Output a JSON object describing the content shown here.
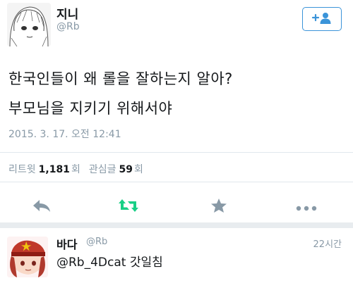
{
  "tweet": {
    "display_name": "지니",
    "handle": "@Rb",
    "text_line1": "한국인들이 왜 롤을 잘하는지 알아?",
    "text_line2": "부모님을 지키기 위해서야",
    "timestamp": "2015. 3. 17. 오전 12:41",
    "follow_icon": "add-user-icon",
    "stats": {
      "retweets_label": "리트윗",
      "retweets_value": "1,181",
      "retweets_unit": "회",
      "favorites_label": "관심글",
      "favorites_value": "59",
      "favorites_unit": "회"
    },
    "actions": {
      "reply_icon": "reply-icon",
      "retweet_icon": "retweet-icon",
      "favorite_icon": "star-icon",
      "more_icon": "more-icon"
    }
  },
  "reply": {
    "display_name": "바다",
    "handle": "@Rb",
    "time": "22시간",
    "text": "@Rb_4Dcat 갓일침"
  },
  "colors": {
    "accent": "#3b94d9",
    "retweet_green": "#19cf86",
    "icon_gray": "#8899a6",
    "text": "#14171a",
    "divider": "#e1e8ed"
  }
}
